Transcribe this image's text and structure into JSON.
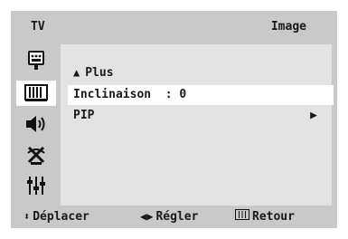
{
  "header": {
    "source_label": "TV",
    "menu_title": "Image"
  },
  "sidebar": {
    "icons": [
      {
        "name": "input-icon",
        "active": false
      },
      {
        "name": "picture-icon",
        "active": true
      },
      {
        "name": "sound-icon",
        "active": false
      },
      {
        "name": "channel-icon",
        "active": false
      },
      {
        "name": "setup-icon",
        "active": false
      }
    ]
  },
  "menu": {
    "items": [
      {
        "label": "Plus",
        "prefix_icon": "triangle-up-icon"
      },
      {
        "label": "Inclinaison  : 0",
        "selected": true
      },
      {
        "label": "PIP",
        "suffix_icon": "triangle-right-icon"
      }
    ]
  },
  "footer": {
    "move_label": "Déplacer",
    "adjust_label": "Régler",
    "back_label": "Retour"
  },
  "colors": {
    "panel": "#c9c9c9",
    "content": "#e3e3e3",
    "highlight": "#ffffff",
    "text": "#1a1a1a"
  }
}
